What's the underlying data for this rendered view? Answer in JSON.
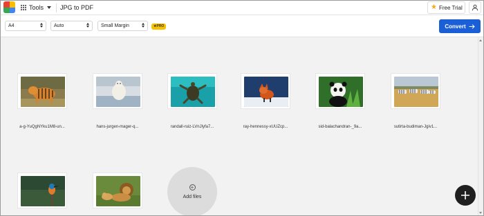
{
  "header": {
    "tools_label": "Tools",
    "app_title": "JPG to PDF",
    "free_trial_label": "Free Trial",
    "logo_colors": [
      "#e94235",
      "#34a853",
      "#fbbc04",
      "#4285f4"
    ]
  },
  "toolbar": {
    "page_size": "A4",
    "orientation": "Auto",
    "margin": "Small Margin",
    "pro_badge": "PRO",
    "convert_label": "Convert",
    "convert_color": "#1a5fd6"
  },
  "files": [
    {
      "name": "a-g-YuQgNYku1M8-un...",
      "icon": "tiger-photo"
    },
    {
      "name": "hans-jurgen-mager-q...",
      "icon": "polar-bear-photo"
    },
    {
      "name": "randall-ruiz-LVnJlyfa7...",
      "icon": "sea-turtle-photo"
    },
    {
      "name": "ray-hennessy-xUUZcp...",
      "icon": "fox-photo"
    },
    {
      "name": "sid-balachandran-_9a...",
      "icon": "panda-photo"
    },
    {
      "name": "sutirta-budiman-Jgiv1...",
      "icon": "zebras-photo"
    },
    {
      "name": "",
      "icon": "kingfisher-photo"
    },
    {
      "name": "",
      "icon": "lions-photo"
    }
  ],
  "add_files_label": "Add files"
}
